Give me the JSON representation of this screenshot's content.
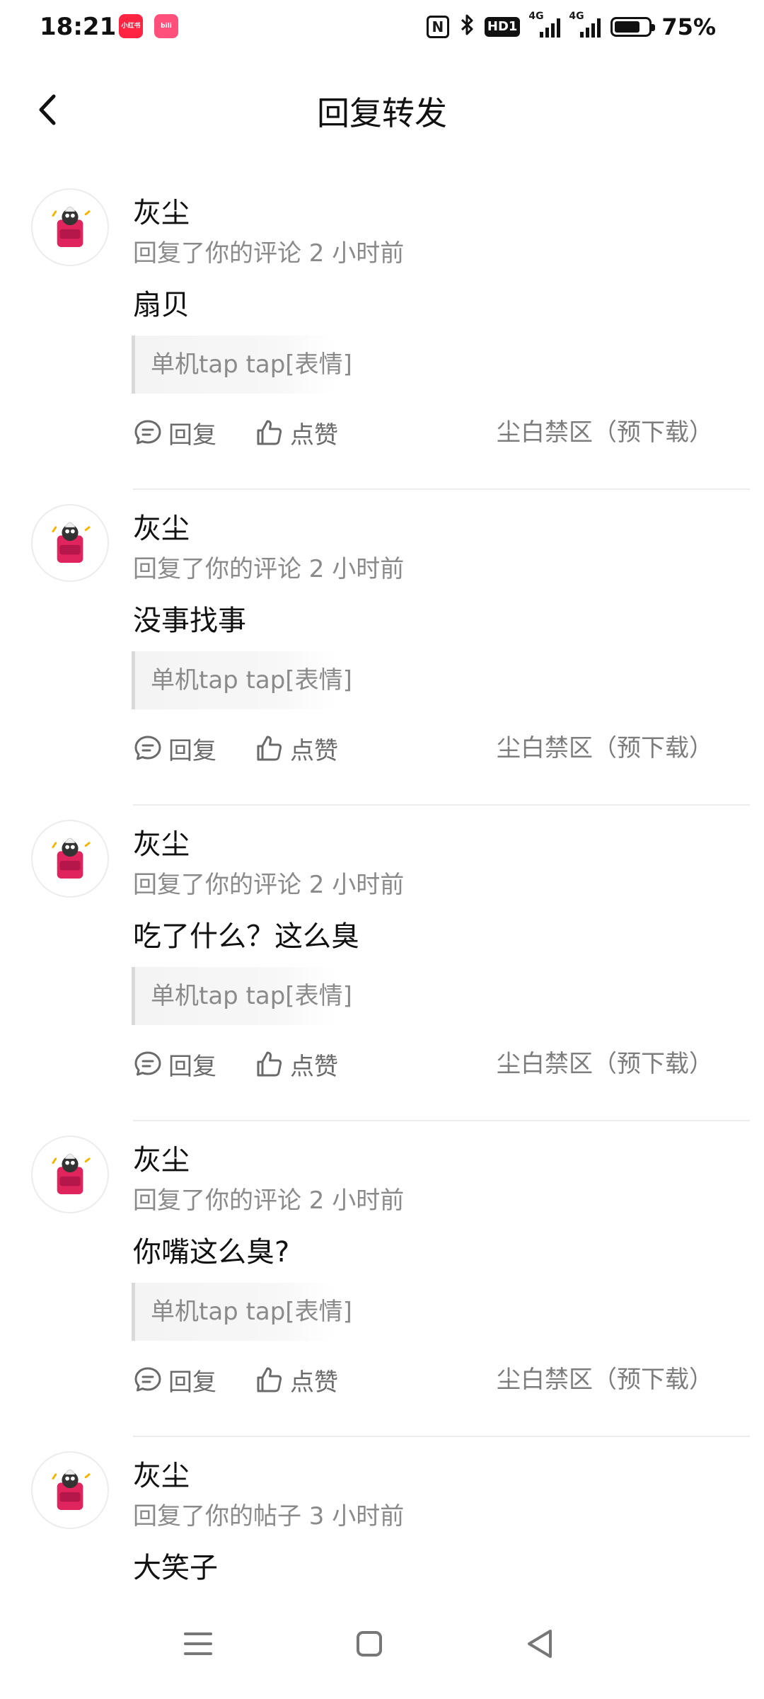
{
  "status_bar": {
    "time": "18:21",
    "apps": [
      "小红书",
      "bili"
    ],
    "hd_badge": "HD1",
    "network_1": "4G",
    "network_2": "4G",
    "battery_percent": "75%",
    "battery_level": 0.75
  },
  "header": {
    "title": "回复转发"
  },
  "items": [
    {
      "username": "灰尘",
      "meta": "回复了你的评论 2 小时前",
      "content": "扇贝",
      "quote": "单机tap tap[表情]",
      "reply_label": "回复",
      "like_label": "点赞",
      "source": "尘白禁区（预下载）"
    },
    {
      "username": "灰尘",
      "meta": "回复了你的评论 2 小时前",
      "content": "没事找事",
      "quote": "单机tap tap[表情]",
      "reply_label": "回复",
      "like_label": "点赞",
      "source": "尘白禁区（预下载）"
    },
    {
      "username": "灰尘",
      "meta": "回复了你的评论 2 小时前",
      "content": "吃了什么？这么臭",
      "quote": "单机tap tap[表情]",
      "reply_label": "回复",
      "like_label": "点赞",
      "source": "尘白禁区（预下载）"
    },
    {
      "username": "灰尘",
      "meta": "回复了你的评论 2 小时前",
      "content": "你嘴这么臭?",
      "quote": "单机tap tap[表情]",
      "reply_label": "回复",
      "like_label": "点赞",
      "source": "尘白禁区（预下载）"
    },
    {
      "username": "灰尘",
      "meta": "回复了你的帖子 3 小时前",
      "content": "大笑子"
    }
  ],
  "icons": {
    "back": "chevron-left-icon",
    "reply": "comment-icon",
    "like": "thumbs-up-icon",
    "nav_menu": "menu-icon",
    "nav_home": "square-icon",
    "nav_back": "triangle-back-icon"
  },
  "colors": {
    "accent_app": "#ff2442",
    "secondary_text": "#8a8a8a",
    "divider": "#ededed"
  }
}
